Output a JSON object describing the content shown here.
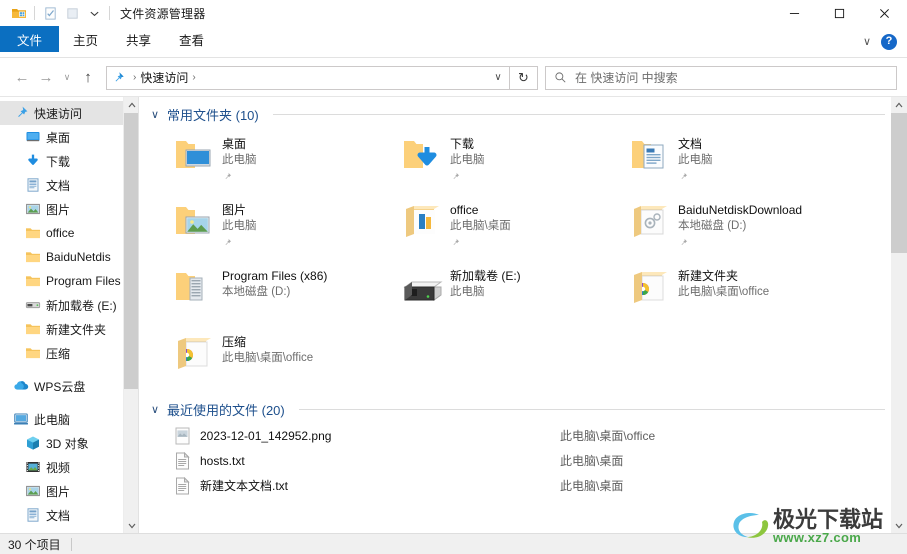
{
  "window": {
    "title": "文件资源管理器",
    "quick_access_icons": [
      "explorer-icon",
      "properties-icon",
      "new-folder-icon",
      "customize-chevron-icon"
    ],
    "caption": {
      "minimize": "—",
      "maximize": "□",
      "close": "✕"
    }
  },
  "ribbon": {
    "tabs": [
      {
        "label": "文件",
        "active": true
      },
      {
        "label": "主页",
        "active": false
      },
      {
        "label": "共享",
        "active": false
      },
      {
        "label": "查看",
        "active": false
      }
    ],
    "collapse_glyph": "∨",
    "help_label": "?"
  },
  "address_bar": {
    "back": "←",
    "forward": "→",
    "history": "∨",
    "up": "↑",
    "crumb_icon": "quick-access-pin-icon",
    "crumbs": [
      "快速访问"
    ],
    "separator": "›",
    "dropdown": "∨",
    "refresh": "↻"
  },
  "search": {
    "placeholder": "在 快速访问 中搜索",
    "icon": "search-icon"
  },
  "sidebar": {
    "items": [
      {
        "label": "快速访问",
        "icon": "pin-star-icon",
        "level": 0,
        "selected": true,
        "pinned": false
      },
      {
        "label": "桌面",
        "icon": "desktop-icon",
        "level": 1,
        "selected": false,
        "pinned": true
      },
      {
        "label": "下载",
        "icon": "download-icon",
        "level": 1,
        "selected": false,
        "pinned": true
      },
      {
        "label": "文档",
        "icon": "documents-icon",
        "level": 1,
        "selected": false,
        "pinned": true
      },
      {
        "label": "图片",
        "icon": "pictures-icon",
        "level": 1,
        "selected": false,
        "pinned": true
      },
      {
        "label": "office",
        "icon": "folder-icon",
        "level": 1,
        "selected": false,
        "pinned": true
      },
      {
        "label": "BaiduNetdis",
        "icon": "folder-icon",
        "level": 1,
        "selected": false,
        "pinned": true
      },
      {
        "label": "Program Files (",
        "icon": "folder-icon",
        "level": 1,
        "selected": false,
        "pinned": false
      },
      {
        "label": "新加载卷 (E:)",
        "icon": "drive-icon",
        "level": 1,
        "selected": false,
        "pinned": false
      },
      {
        "label": "新建文件夹",
        "icon": "folder-icon",
        "level": 1,
        "selected": false,
        "pinned": false
      },
      {
        "label": "压缩",
        "icon": "folder-icon",
        "level": 1,
        "selected": false,
        "pinned": false
      },
      {
        "label": "WPS云盘",
        "icon": "wps-cloud-icon",
        "level": 0,
        "selected": false,
        "pinned": false,
        "gap_before": true
      },
      {
        "label": "此电脑",
        "icon": "this-pc-icon",
        "level": 0,
        "selected": false,
        "pinned": false,
        "gap_before": true
      },
      {
        "label": "3D 对象",
        "icon": "3d-objects-icon",
        "level": 1,
        "selected": false,
        "pinned": false
      },
      {
        "label": "视频",
        "icon": "videos-icon",
        "level": 1,
        "selected": false,
        "pinned": false
      },
      {
        "label": "图片",
        "icon": "pictures-icon",
        "level": 1,
        "selected": false,
        "pinned": false
      },
      {
        "label": "文档",
        "icon": "documents-icon",
        "level": 1,
        "selected": false,
        "pinned": false
      }
    ]
  },
  "main": {
    "frequent": {
      "chevron": "∨",
      "title": "常用文件夹 (10)",
      "tiles": [
        {
          "name": "桌面",
          "sub": "此电脑",
          "icon": "folder-desktop-icon",
          "pinned": true
        },
        {
          "name": "下载",
          "sub": "此电脑",
          "icon": "folder-download-icon",
          "pinned": true
        },
        {
          "name": "文档",
          "sub": "此电脑",
          "icon": "folder-documents-icon",
          "pinned": true
        },
        {
          "name": "图片",
          "sub": "此电脑",
          "icon": "folder-pictures-icon",
          "pinned": true
        },
        {
          "name": "office",
          "sub": "此电脑\\桌面",
          "icon": "folder-office-icon",
          "pinned": true
        },
        {
          "name": "BaiduNetdiskDownload",
          "sub": "本地磁盘 (D:)",
          "icon": "folder-baidu-icon",
          "pinned": true
        },
        {
          "name": "Program Files (x86)",
          "sub": "本地磁盘 (D:)",
          "icon": "folder-programfiles-icon",
          "pinned": false
        },
        {
          "name": "新加载卷 (E:)",
          "sub": "此电脑",
          "icon": "drive-large-icon",
          "pinned": false
        },
        {
          "name": "新建文件夹",
          "sub": "此电脑\\桌面\\office",
          "icon": "folder-color-icon",
          "pinned": false
        },
        {
          "name": "压缩",
          "sub": "此电脑\\桌面\\office",
          "icon": "folder-color-icon",
          "pinned": false
        }
      ]
    },
    "recent": {
      "chevron": "∨",
      "title": "最近使用的文件 (20)",
      "rows": [
        {
          "name": "2023-12-01_142952.png",
          "path": "此电脑\\桌面\\office",
          "icon": "image-file-icon"
        },
        {
          "name": "hosts.txt",
          "path": "此电脑\\桌面",
          "icon": "text-file-icon"
        },
        {
          "name": "新建文本文档.txt",
          "path": "此电脑\\桌面",
          "icon": "text-file-icon"
        }
      ]
    }
  },
  "status": {
    "item_count": "30 个项目"
  },
  "watermark": {
    "name": "极光下载站",
    "url": "www.xz7.com"
  },
  "colors": {
    "accent": "#0b6fc1",
    "group_title": "#1d4f8c",
    "folder_yellow": "#ffd070",
    "selection": "#e4e4e4"
  }
}
